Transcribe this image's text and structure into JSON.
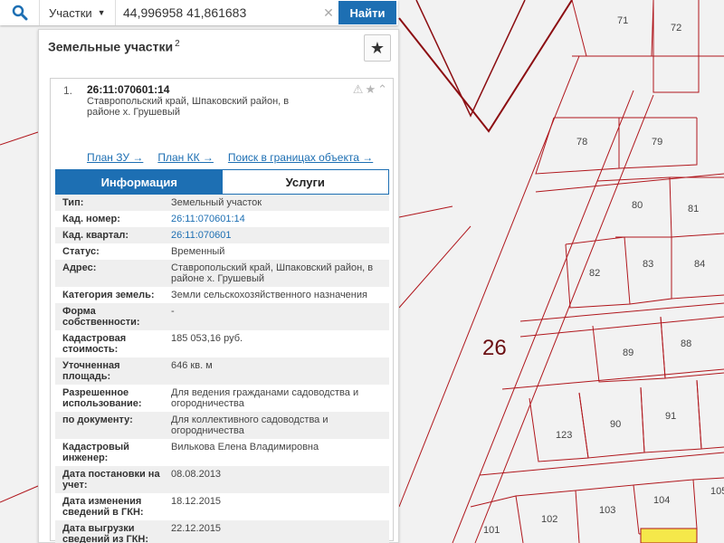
{
  "search": {
    "dropdown_label": "Участки",
    "query": "44,996958 41,861683",
    "clear": "✕",
    "button_label": "Найти"
  },
  "panel": {
    "title": "Земельные участки",
    "count": "2",
    "star": "★"
  },
  "item": {
    "number": "1.",
    "code": "26:11:070601:14",
    "address": "Ставропольский край, Шпаковский район, в районе х. Грушевый",
    "icons": [
      "warning-icon",
      "star-icon",
      "chevron-up-icon"
    ]
  },
  "links": [
    {
      "label": "План ЗУ →"
    },
    {
      "label": "План КК →"
    },
    {
      "label": "Поиск в границах объекта →"
    }
  ],
  "tabs": [
    {
      "label": "Информация",
      "active": true
    },
    {
      "label": "Услуги",
      "active": false
    }
  ],
  "info_rows": [
    {
      "key": "Тип:",
      "value": "Земельный участок"
    },
    {
      "key": "Кад. номер:",
      "value": "26:11:070601:14",
      "link": true
    },
    {
      "key": "Кад. квартал:",
      "value": "26:11:070601",
      "link": true
    },
    {
      "key": "Статус:",
      "value": "Временный"
    },
    {
      "key": "Адрес:",
      "value": "Ставропольский край, Шпаковский район, в районе х. Грушевый"
    },
    {
      "key": "Категория земель:",
      "value": "Земли сельскохозяйственного назначения"
    },
    {
      "key": "Форма собственности:",
      "value": "-"
    },
    {
      "key": "Кадастровая стоимость:",
      "value": "185 053,16 руб."
    },
    {
      "key": "Уточненная площадь:",
      "value": "646 кв. м"
    },
    {
      "key": "Разрешенное использование:",
      "value": "Для ведения гражданами садоводства и огородничества"
    },
    {
      "key": "по документу:",
      "value": "Для коллективного садоводства и огородничества"
    },
    {
      "key": "Кадастровый инженер:",
      "value": "Вилькова Елена Владимировна"
    },
    {
      "key": "Дата постановки на учет:",
      "value": "08.08.2013"
    },
    {
      "key": "Дата изменения сведений в ГКН:",
      "value": "18.12.2015"
    },
    {
      "key": "Дата выгрузки сведений из ГКН:",
      "value": "22.12.2015"
    }
  ],
  "map": {
    "block_label": "26",
    "plot_labels": [
      "71",
      "72",
      "78",
      "79",
      "80",
      "81",
      "82",
      "83",
      "84",
      "89",
      "88",
      "123",
      "90",
      "91",
      "101",
      "102",
      "103",
      "104",
      "105"
    ],
    "line_color": "#b0161c"
  },
  "colors": {
    "accent": "#1d6fb3",
    "map_bg": "#f2f2f2",
    "highlight": "#f5e84a"
  }
}
